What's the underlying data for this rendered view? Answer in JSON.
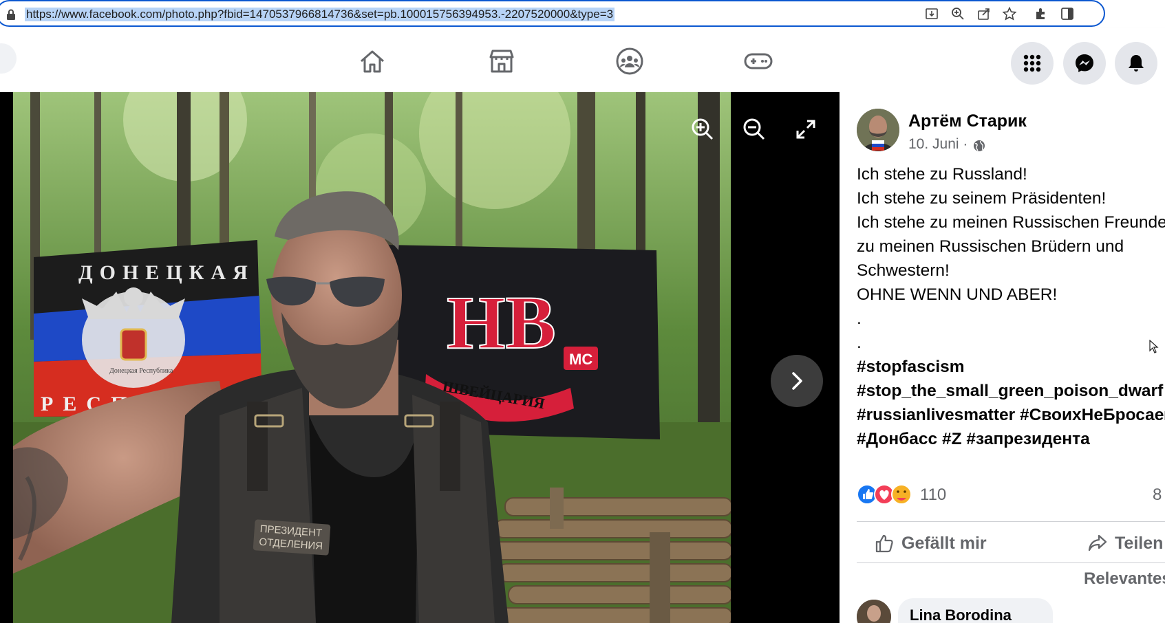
{
  "browser": {
    "url": "https://www.facebook.com/photo.php?fbid=1470537966814736&set=pb.100015756394953.-2207520000&type=3",
    "toolbar_icons": [
      "download-icon",
      "zoom-icon",
      "share-icon",
      "star-icon",
      "extensions-icon",
      "sidebar-icon"
    ]
  },
  "fb_nav": {
    "tabs": [
      "home-icon",
      "marketplace-icon",
      "groups-icon",
      "gaming-icon"
    ],
    "right_buttons": [
      "menu-grid-icon",
      "messenger-icon",
      "notifications-icon"
    ]
  },
  "photo": {
    "flag_left_text_top": "ДОНЕЦКАЯ",
    "flag_left_text_bottom": "РЕСПУ",
    "flag_left_emblem_text": "Донецкая Республика",
    "flag_right_logo": "НВ",
    "flag_right_badge": "МС",
    "flag_right_banner": "ШВЕЙЦАРИЯ",
    "vest_patch_line1": "ПРЕЗИДЕНТ",
    "vest_patch_line2": "ОТДЕЛЕНИЯ"
  },
  "post": {
    "author": "Артём Старик",
    "date": "10. Juni ·",
    "lines": [
      "Ich stehe zu Russland!",
      "Ich stehe zu seinem Präsidenten!",
      "Ich stehe zu meinen Russischen Freunden,",
      "zu meinen Russischen Brüdern und",
      "Schwestern!",
      "OHNE WENN UND ABER!",
      ".",
      "."
    ],
    "hashtag_lines": [
      "#stopfascism",
      "#stop_the_small_green_poison_dwarf",
      "#russianlivesmatter #СвоихНеБросаем",
      "#Донбасс #Z #запрезидента"
    ],
    "reaction_count": "110",
    "comment_count": "8",
    "like_label": "Gefällt mir",
    "share_label": "Teilen",
    "sort_label": "Relevanteste",
    "first_commenter": "Lina Borodina"
  },
  "colors": {
    "facebook_blue": "#1877f2",
    "secondary_text": "#65676b",
    "button_grey": "#e4e6eb",
    "url_highlight": "#b7d3f6"
  }
}
